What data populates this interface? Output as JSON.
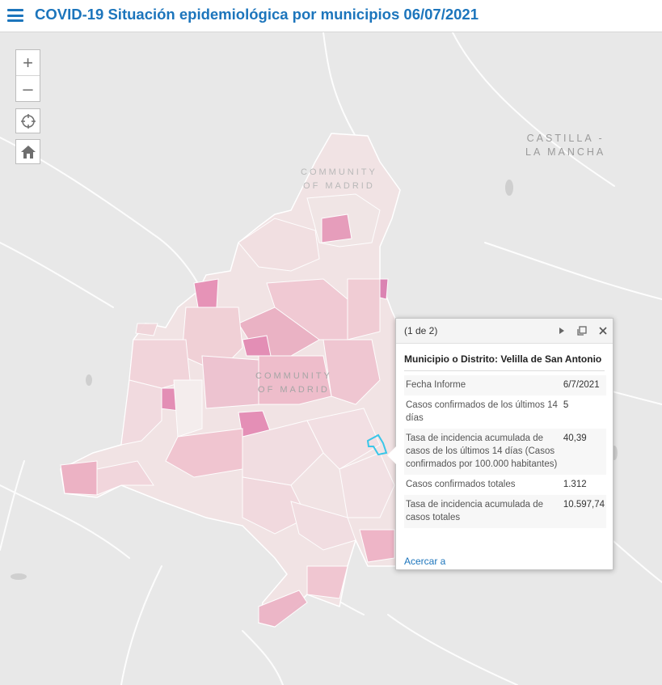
{
  "header": {
    "title": "COVID-19 Situación epidemiológica por municipios 06/07/2021"
  },
  "map_controls": {
    "zoom_in": "+",
    "zoom_out": "–"
  },
  "map_labels": {
    "castilla_line1": "CASTILLA -",
    "castilla_line2": "LA MANCHA",
    "community_north_line1": "COMMUNITY",
    "community_north_line2": "OF MADRID",
    "community_center_line1": "COMMUNITY",
    "community_center_line2": "OF MADRID"
  },
  "colors": {
    "accent": "#1c75bc",
    "basemap": "#e8e8e8",
    "selected_outline": "#39c6e8",
    "choropleth_light": "#f4ecec",
    "choropleth_high": "#e27fb0"
  },
  "popup": {
    "count": "(1 de 2)",
    "title": "Municipio o Distrito: Velilla de San Antonio",
    "rows": [
      {
        "label": "Fecha Informe",
        "value": "6/7/2021"
      },
      {
        "label": "Casos confirmados de los últimos 14 días",
        "value": "5"
      },
      {
        "label": "Tasa de incidencia acumulada de casos de los últimos 14 días (Casos confirmados por 100.000 habitantes)",
        "value": "40,39"
      },
      {
        "label": "Casos confirmados totales",
        "value": "1.312"
      },
      {
        "label": "Tasa de incidencia acumulada de casos totales",
        "value": "10.597,74"
      }
    ],
    "zoom_link": "Acercar a"
  }
}
